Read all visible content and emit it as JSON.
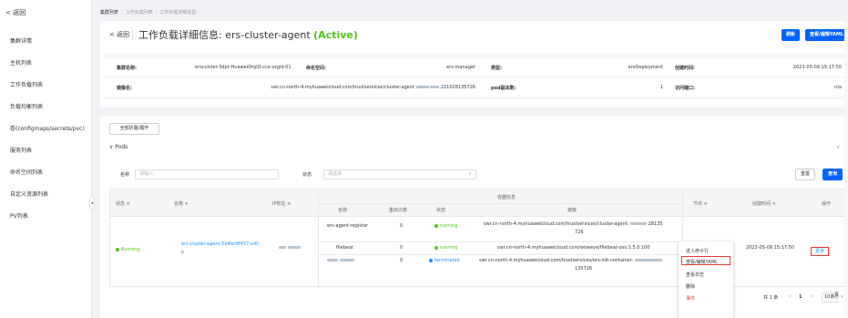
{
  "sidebar": {
    "back": "< 返回",
    "items": [
      "集群详情",
      "主机列表",
      "工作负载列表",
      "负载均衡列表",
      "卷(configmaps/secrets/pvc)",
      "服务列表",
      "命名空间列表",
      "自定义资源列表",
      "PV列表"
    ],
    "handle": "◂"
  },
  "breadcrumb": {
    "items": [
      "集群列表",
      "工作负载列表",
      "工作负载详细信息"
    ]
  },
  "header": {
    "back": "< 返回",
    "title_prefix": "工作负载详细信息: ers-cluster-agent",
    "status": "(Active)",
    "refresh": "刷新",
    "view_yaml": "查看/编辑YAML"
  },
  "info": {
    "row1": [
      {
        "label": "集群名称:",
        "value": "ersculster-3dpt-HuaweiOrgID-cce-orgid-01"
      },
      {
        "label": "命名空间:",
        "value": "ers-manager"
      },
      {
        "label": "类型:",
        "value": "ersDeployment"
      },
      {
        "label": "创建时间:",
        "value": "2023-05-09 15:17:50"
      }
    ],
    "row2": [
      {
        "label": "镜像名:",
        "value": "swr.cn-north-4.myhuaweicloud.com/trustservices/cluster-agent",
        "suffix": "221028135726"
      },
      {
        "label": "pod副本数:",
        "value": "1"
      },
      {
        "label": "访问端口:",
        "value": "n/a"
      }
    ]
  },
  "toolbar": {
    "toggle_all": "全部折叠/展开"
  },
  "pods": {
    "header": "∨ Pods",
    "chevron": "∨"
  },
  "filters": {
    "name_label": "名称",
    "name_placeholder": "请输入",
    "status_label": "状态",
    "status_placeholder": "请选择",
    "reset": "重置",
    "search": "查询"
  },
  "table": {
    "headers": {
      "status": "状态 ≑",
      "name": "名称 ≑",
      "ip": "IP地址 ≑",
      "container_info": "容器信息",
      "node": "节点 ≑",
      "created": "创建时间 ≑",
      "actions": "操作"
    },
    "sub_headers": {
      "name": "名称",
      "restarts": "重启次数",
      "status": "状态",
      "image": "镜像"
    },
    "row": {
      "status": "Running",
      "name_line1": "ers-cluster-agent-5b4bc9f457-x4ll",
      "name_line2": "p",
      "created": "2023-05-09 15:17:50",
      "more": "更多"
    },
    "containers": [
      {
        "name": "ers-agent-register",
        "restarts": "0",
        "status": "running",
        "image_line1": "swr.cn-north-4.myhuaweicloud.com/trustservices/cluster-agent:",
        "image_suffix": "28135",
        "image_line2": "726"
      },
      {
        "name": "filebeat",
        "restarts": "0",
        "status": "running",
        "image_line1": "swr.cn-north-4.myhuaweicloud.com/wiseeye/filebeat-oss:1.5.0.100"
      },
      {
        "name": "",
        "restarts": "0",
        "status": "terminated",
        "image_line1": "swr.cn-north-4.myhuaweicloud.com/trustservices/ers-init-container:",
        "image_line2": "135726"
      }
    ]
  },
  "menu": {
    "items": [
      "进入命令行",
      "查看/编辑YAML",
      "查看日志",
      "删除",
      "事件"
    ]
  },
  "pager": {
    "total": "共 1 条",
    "prev": "<",
    "page": "1",
    "next": ">",
    "page_size": "10条/页",
    "chev": "∨",
    "goto": "页"
  },
  "colors": {
    "accent": "#0062ff",
    "running": "#52c41a",
    "terminated": "#1890ff",
    "highlight": "#e53935"
  }
}
